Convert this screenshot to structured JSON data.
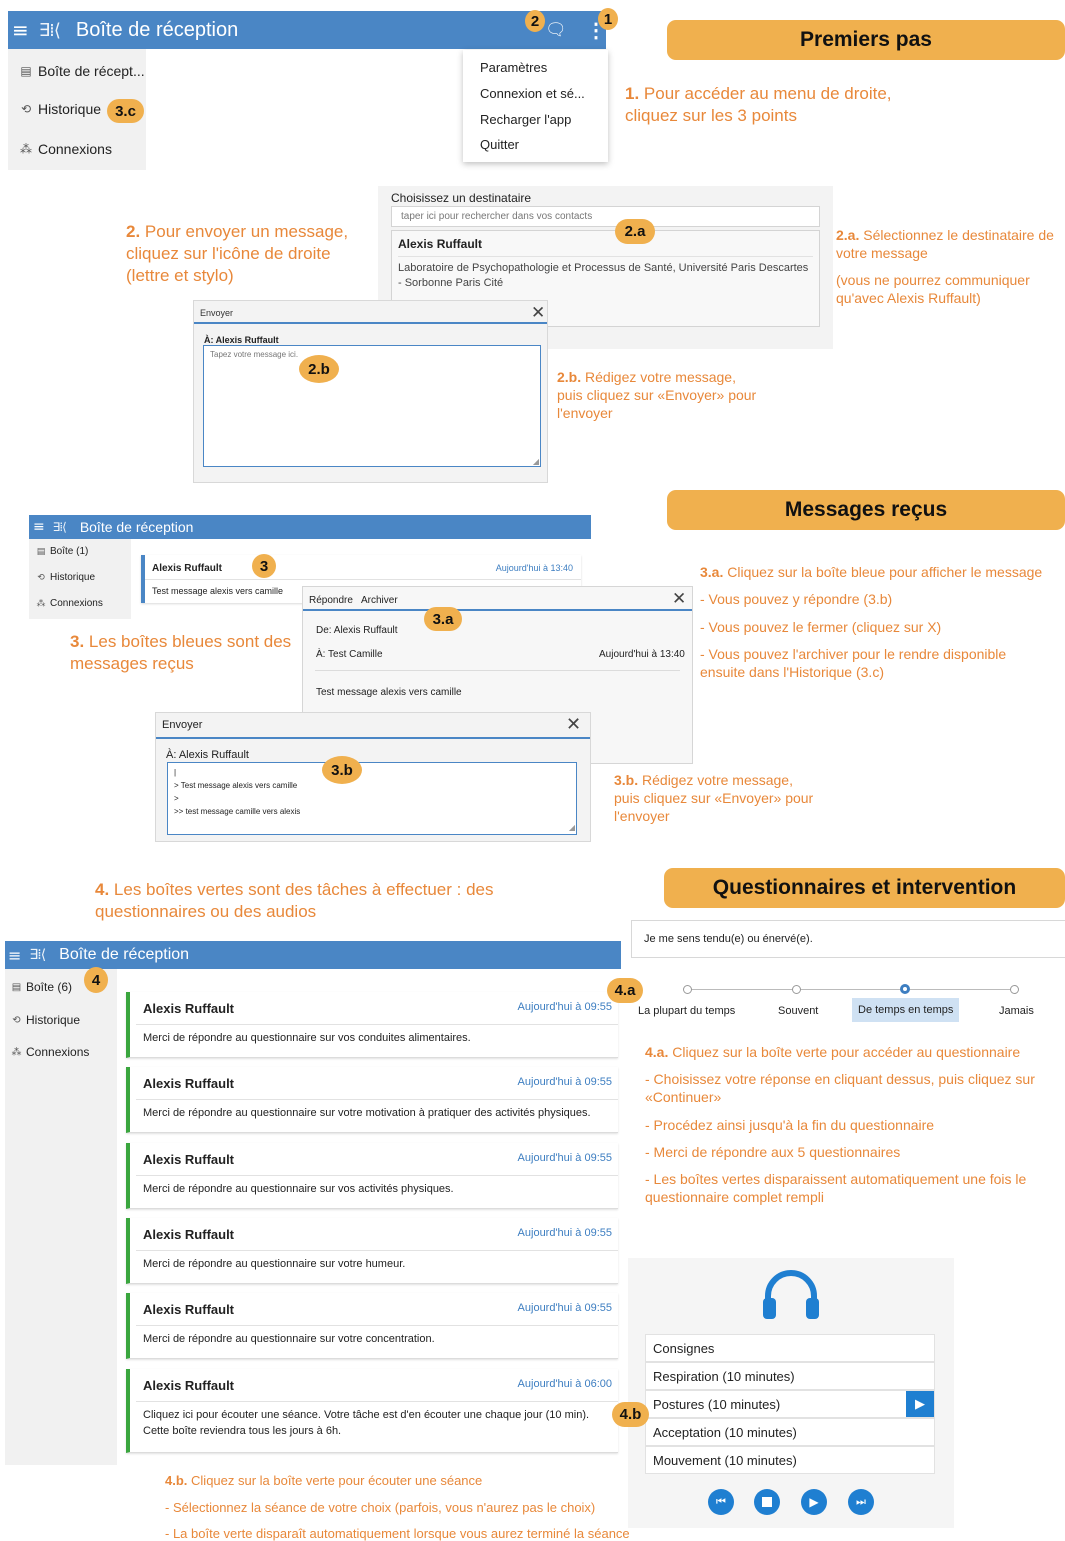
{
  "colors": {
    "appbar": "#4a86c5",
    "accent_orange": "#f0b04e",
    "note_orange": "#e8883a",
    "task_green": "#3aa63e",
    "link_blue": "#3d7ec1",
    "audio_blue": "#1f7fd1"
  },
  "icons": {
    "menu": "hamburger-icon",
    "logo": "app-logo-icon",
    "compose": "compose-icon",
    "more": "more-vert-icon",
    "inbox": "inbox-icon",
    "history": "history-icon",
    "connections": "connections-icon",
    "close": "close-icon",
    "headphones": "headphones-icon"
  },
  "section1": {
    "app_title": "Boîte de réception",
    "sidebar": {
      "inbox": "Boîte de récept...",
      "history": "Historique",
      "connections": "Connexions"
    },
    "menu": [
      "Paramètres",
      "Connexion et sé...",
      "Recharger l'app",
      "Quitter"
    ],
    "header": "Premiers pas",
    "step1_num": "1.",
    "step1_text": "Pour accéder au menu de droite, cliquez sur les 3 points"
  },
  "badges": {
    "b1": "1",
    "b2": "2",
    "b3c": "3.c",
    "b2a": "2.a",
    "b2b": "2.b",
    "b3": "3",
    "b3a": "3.a",
    "b3b": "3.b",
    "b4": "4",
    "b4a": "4.a",
    "b4b": "4.b"
  },
  "section2": {
    "step2_num": "2.",
    "step2_text": "Pour envoyer un message, cliquez sur l'icône de droite (lettre et stylo)",
    "recipient_label": "Choisissez un destinataire",
    "search_placeholder": "taper ici pour rechercher dans vos contacts",
    "recipient_name": "Alexis Ruffault",
    "recipient_org": "Laboratoire de Psychopathologie et Processus de Santé, Université Paris Descartes - Sorbonne Paris Cité",
    "note2a_num": "2.a.",
    "note2a_text": "Sélectionnez le destinataire de votre message",
    "note2a_extra": "(vous ne pourrez communiquer qu'avec Alexis Ruffault)",
    "send_title": "Envoyer",
    "to_label": "À: Alexis Ruffault",
    "message_placeholder": "Tapez votre message ici.",
    "note2b_num": "2.b.",
    "note2b_text": "Rédigez votre message, puis cliquez sur «Envoyer» pour l'envoyer"
  },
  "section3": {
    "header": "Messages reçus",
    "app_title": "Boîte de réception",
    "sidebar": {
      "inbox": "Boîte (1)",
      "history": "Historique",
      "connections": "Connexions"
    },
    "msg_from": "Alexis Ruffault",
    "msg_time": "Aujourd'hui à 13:40",
    "msg_preview": "Test message alexis vers camille",
    "reply_label": "Répondre",
    "archive_label": "Archiver",
    "detail_from": "De: Alexis Ruffault",
    "detail_to": "À: Test Camille",
    "detail_time": "Aujourd'hui à 13:40",
    "detail_body": "Test message alexis vers camille",
    "note3_num": "3.",
    "note3_text": "Les boîtes bleues sont des messages reçus",
    "note3a_num": "3.a.",
    "note3a_text": "Cliquez sur la boîte bleue pour afficher le message",
    "note3a_l1": "- Vous pouvez y répondre (3.b)",
    "note3a_l2": "- Vous pouvez le fermer (cliquez sur X)",
    "note3a_l3": "- Vous pouvez l'archiver pour le rendre disponible ensuite dans l'Historique (3.c)",
    "send_title": "Envoyer",
    "to_label": "À: Alexis Ruffault",
    "reply_lines": [
      "|",
      "> Test message alexis vers camille",
      ">",
      ">> test message camille vers alexis"
    ],
    "note3b_num": "3.b.",
    "note3b_text": "Rédigez votre message, puis cliquez sur «Envoyer» pour l'envoyer"
  },
  "section4": {
    "note4_num": "4.",
    "note4_text": "Les boîtes vertes sont des tâches à effectuer : des questionnaires ou des audios",
    "header": "Questionnaires et intervention",
    "app_title": "Boîte de réception",
    "sidebar": {
      "inbox": "Boîte (6)",
      "history": "Historique",
      "connections": "Connexions"
    },
    "tasks": [
      {
        "from": "Alexis Ruffault",
        "time": "Aujourd'hui à 09:55",
        "body": "Merci de répondre au questionnaire sur vos conduites alimentaires."
      },
      {
        "from": "Alexis Ruffault",
        "time": "Aujourd'hui à 09:55",
        "body": "Merci de répondre au questionnaire sur votre motivation à pratiquer des activités physiques."
      },
      {
        "from": "Alexis Ruffault",
        "time": "Aujourd'hui à 09:55",
        "body": "Merci de répondre au questionnaire sur vos activités physiques."
      },
      {
        "from": "Alexis Ruffault",
        "time": "Aujourd'hui à 09:55",
        "body": "Merci de répondre au questionnaire sur votre humeur."
      },
      {
        "from": "Alexis Ruffault",
        "time": "Aujourd'hui à 09:55",
        "body": "Merci de répondre au questionnaire sur votre concentration."
      },
      {
        "from": "Alexis Ruffault",
        "time": "Aujourd'hui à 06:00",
        "body": "Cliquez ici pour écouter une séance. Votre tâche est d'en écouter une chaque jour (10 min). Cette boîte reviendra tous les jours à 6h."
      }
    ],
    "question": "Je me sens tendu(e) ou énervé(e).",
    "options": [
      "La plupart du temps",
      "Souvent",
      "De temps en temps",
      "Jamais"
    ],
    "selected_option": "De temps en temps",
    "note4a_num": "4.a.",
    "note4a_text": "Cliquez sur la boîte verte pour accéder au questionnaire",
    "note4a_l1": "- Choisissez votre réponse en cliquant dessus, puis cliquez sur «Continuer»",
    "note4a_l2": "- Procédez ainsi jusqu'à la fin du questionnaire",
    "note4a_l3": "- Merci de répondre aux 5 questionnaires",
    "note4a_l4": "- Les boîtes vertes disparaissent automatiquement une fois le questionnaire complet rempli",
    "audio": [
      "Consignes",
      "Respiration (10 minutes)",
      "Postures (10 minutes)",
      "Acceptation (10 minutes)",
      "Mouvement (10 minutes)"
    ],
    "note4b_num": "4.b.",
    "note4b_text": "Cliquez sur la boîte verte pour écouter une séance",
    "note4b_l1": "- Sélectionnez la séance de votre choix (parfois, vous n'aurez pas le choix)",
    "note4b_l2": "- La boîte verte disparaît automatiquement lorsque vous aurez terminé la séance"
  }
}
